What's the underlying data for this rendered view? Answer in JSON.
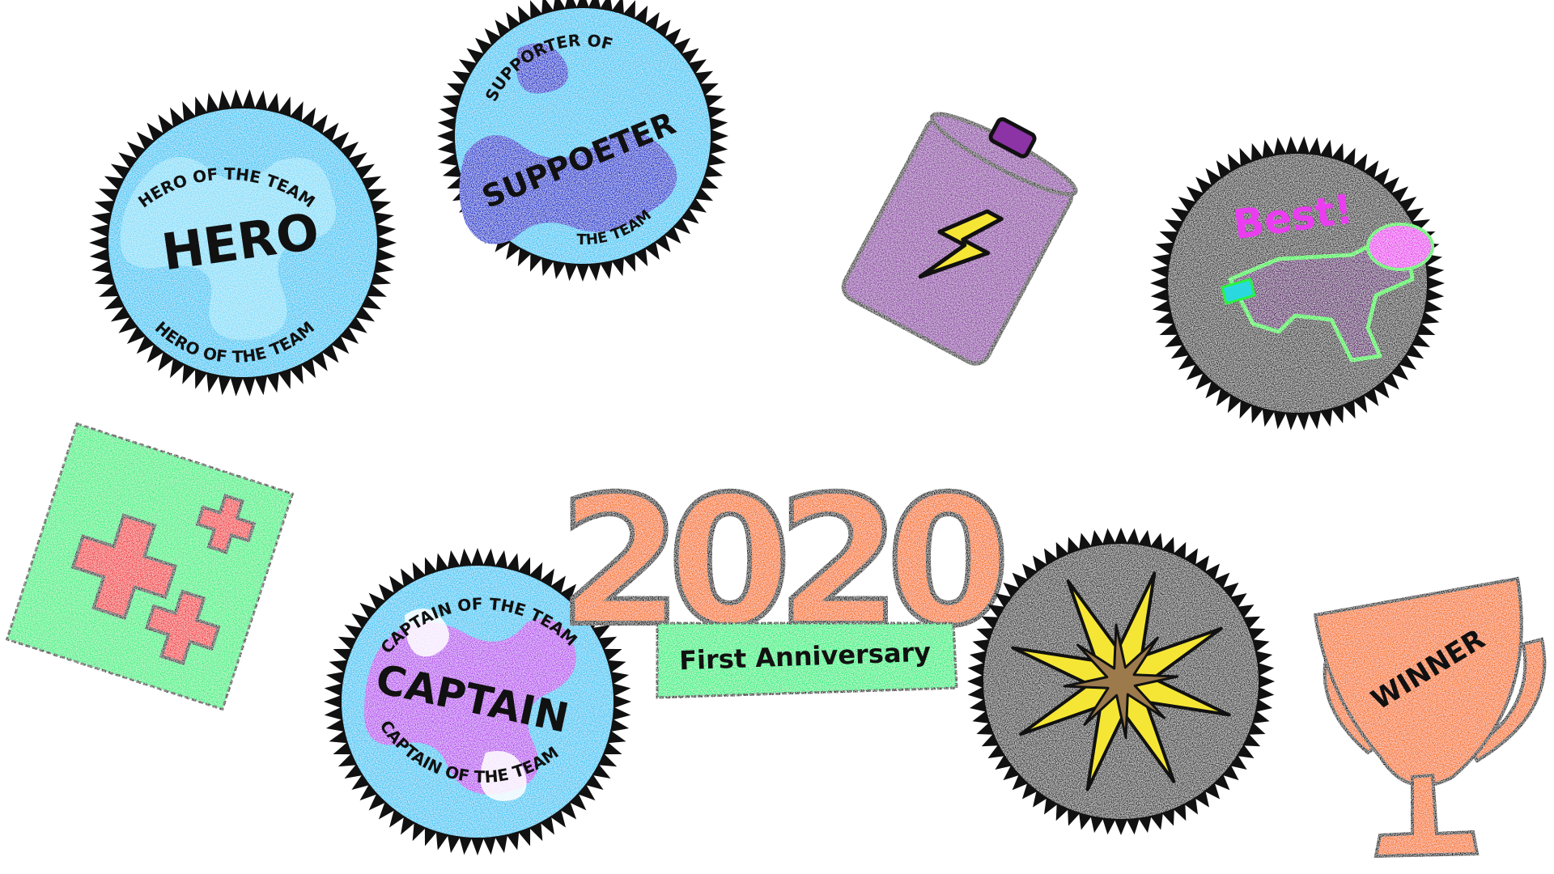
{
  "badges": {
    "hero": {
      "arc_top": "HERO OF THE TEAM",
      "arc_bottom": "HERO OF THE TEAM",
      "main": "HERO"
    },
    "supporter": {
      "arc_top": "SUPPORTER OF",
      "main": "SUPPOETER",
      "arc_bottom": "THE TEAM"
    },
    "battery": {
      "icon": "lightning-icon"
    },
    "best": {
      "label": "Best!",
      "icon": "water-gun-icon"
    },
    "plus": {
      "icon": "plus-icon"
    },
    "captain": {
      "arc_top": "CAPTAIN OF THE TEAM",
      "arc_bottom": "CAPTAIN OF THE TEAM",
      "main": "CAPTAIN"
    },
    "anniversary": {
      "year": "2020",
      "label": "First Anniversary"
    },
    "compass": {
      "icon": "compass-star-icon"
    },
    "trophy": {
      "label": "WINNER",
      "icon": "trophy-icon"
    }
  },
  "colors": {
    "blue_light": "#37c8f5",
    "blue_dark": "#0a2fd0",
    "purple": "#8c33a6",
    "charcoal": "#333030",
    "green": "#26f07f",
    "red": "#f2202a",
    "orange": "#f77212",
    "gold": "#f5e635",
    "magenta": "#ea3df0",
    "neon_green": "#29f23f"
  }
}
